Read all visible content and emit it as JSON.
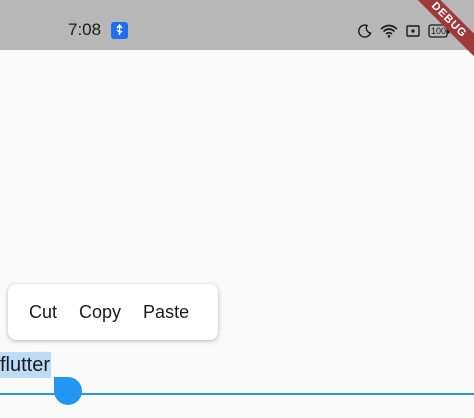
{
  "status_bar": {
    "time": "7:08",
    "battery_level": "100",
    "icons": [
      "usb-debug-icon",
      "do-not-disturb-moon-icon",
      "wifi-icon",
      "cast-icon",
      "battery-icon"
    ]
  },
  "debug_banner": {
    "label": "DEBUG"
  },
  "toolbar": {
    "cut_label": "Cut",
    "copy_label": "Copy",
    "paste_label": "Paste"
  },
  "text_field": {
    "value": "flutter",
    "selected": true
  },
  "colors": {
    "accent": "#2196f3",
    "selection": "#bcdcf8",
    "status_bar": "#b7b7b7",
    "debug_ribbon": "#a03a3a",
    "background": "#fafafa"
  }
}
